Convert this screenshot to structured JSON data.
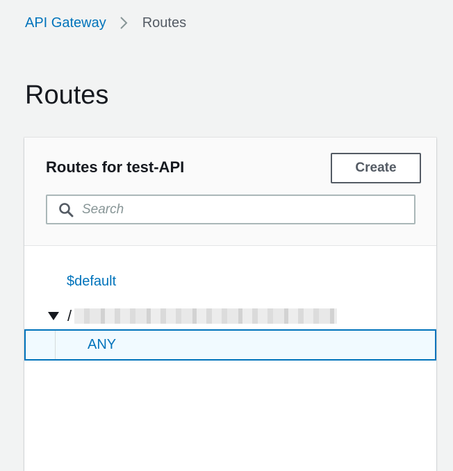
{
  "breadcrumb": {
    "parent": "API Gateway",
    "current": "Routes"
  },
  "page": {
    "title": "Routes"
  },
  "panel": {
    "title": "Routes for test-API",
    "create_label": "Create",
    "search": {
      "placeholder": "Search",
      "value": ""
    }
  },
  "routes": {
    "default_route": "$default",
    "group_path": "/",
    "group_expanded": true,
    "selected_method": "ANY"
  },
  "icons": {
    "breadcrumb_separator": "chevron-right-icon",
    "search": "search-icon",
    "expand": "caret-down-icon"
  },
  "colors": {
    "link": "#0073bb",
    "selected_background": "#f1faff",
    "selected_border": "#0073bb",
    "page_background": "#f2f3f3"
  }
}
